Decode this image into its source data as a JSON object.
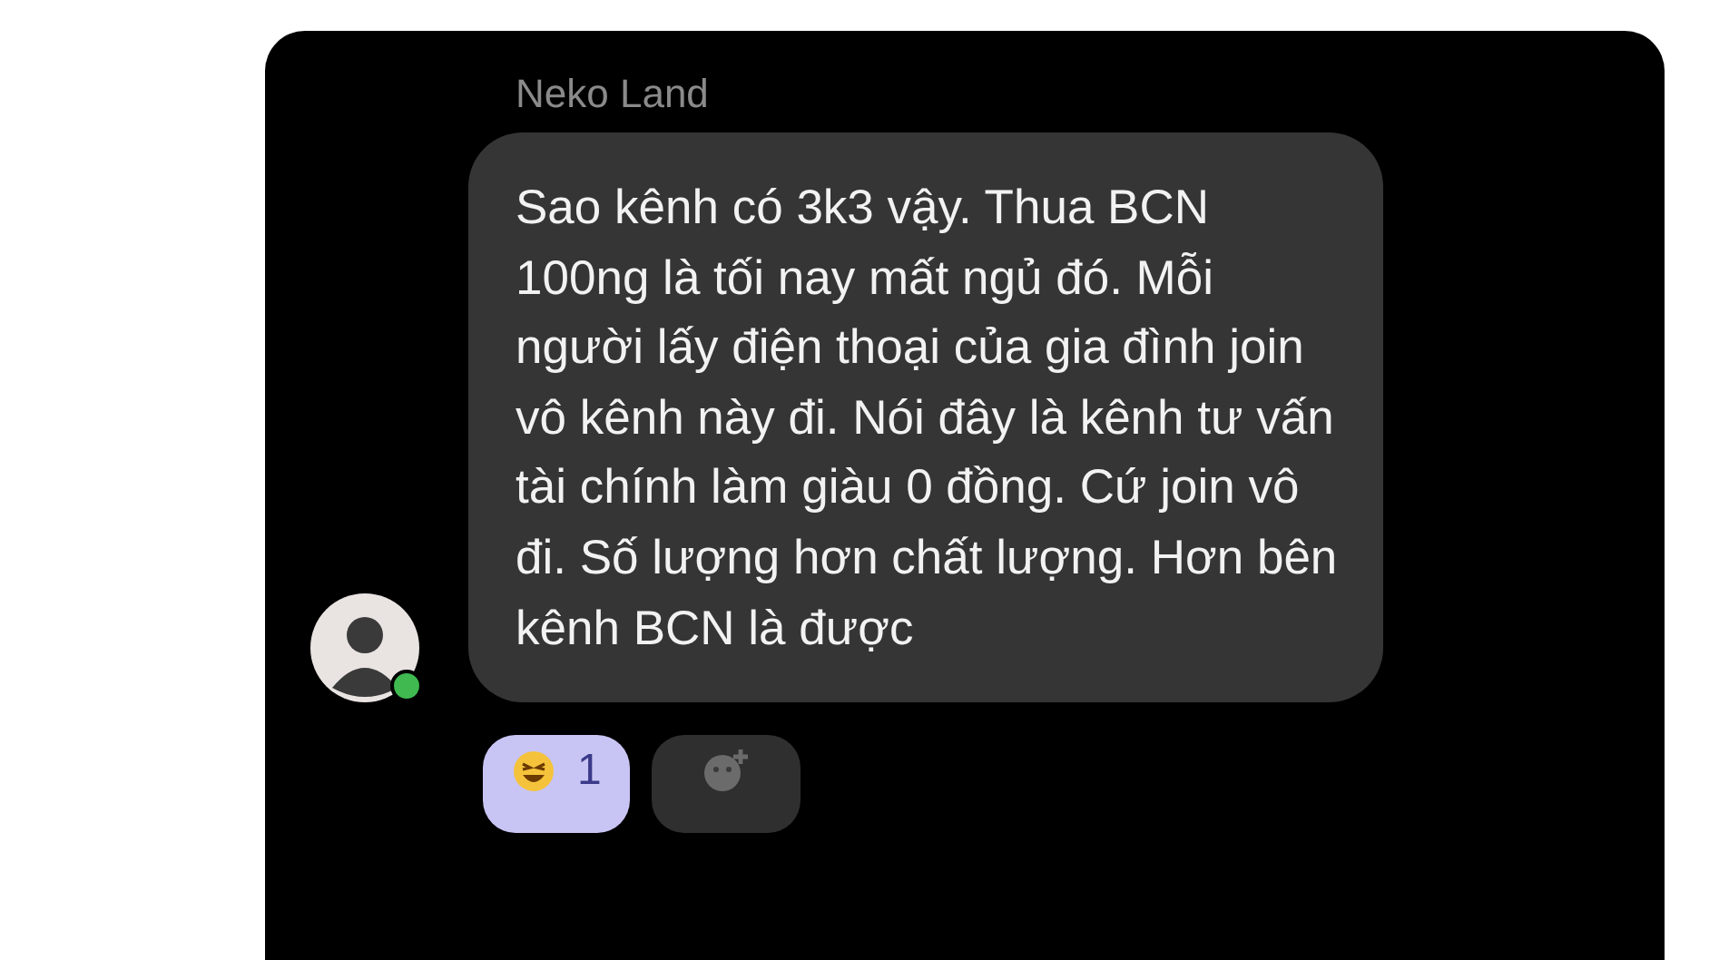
{
  "message": {
    "sender": "Neko Land",
    "online": true,
    "text": "Sao kênh có 3k3 vậy. Thua BCN 100ng là tối nay mất ngủ đó. Mỗi người lấy điện thoại của gia đình join vô kênh này đi. Nói đây là kênh tư vấn tài chính làm giàu 0 đồng. Cứ join vô đi. Số lượng hơn chất lượng. Hơn bên kênh BCN là được",
    "reactions": [
      {
        "count": "1",
        "selected": true
      }
    ]
  }
}
